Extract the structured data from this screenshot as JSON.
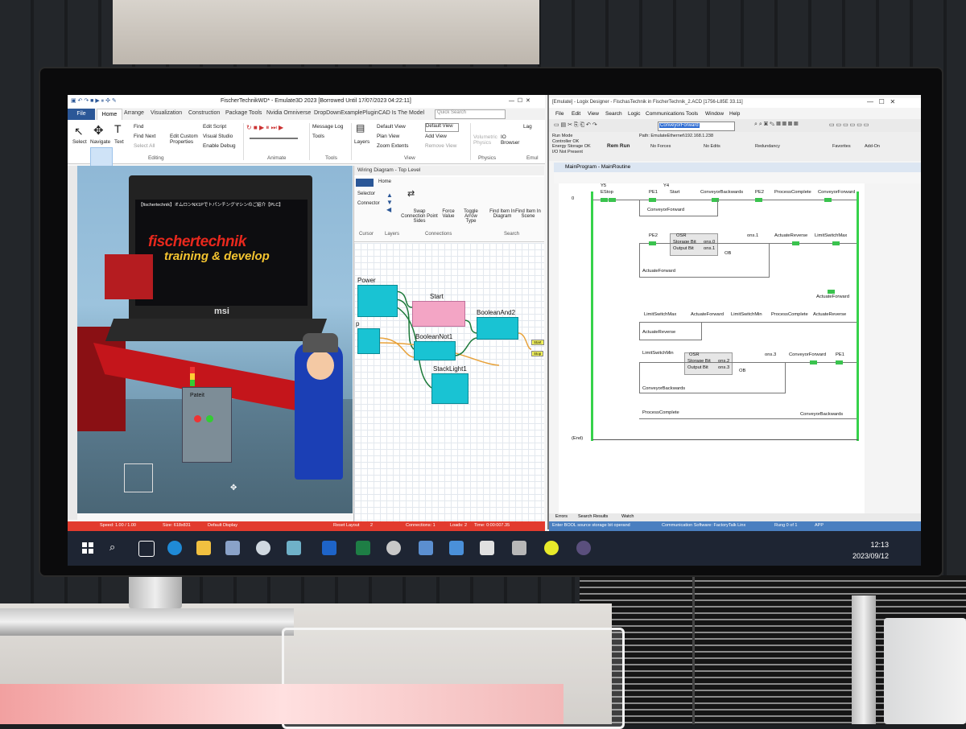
{
  "emulate3d": {
    "title": "FischerTechnikWD* - Emulate3D 2023 [Borrowed Until 17/07/2023 04:22:11]",
    "tabs": [
      "File",
      "Home",
      "Arrange",
      "Visualization",
      "Construction",
      "Package Tools",
      "Nvidia Omniverse",
      "DropDownExamplePlugin",
      "CAD Is The Model"
    ],
    "search_placeholder": "Quick Search",
    "ribbon": {
      "select": "Select",
      "navigate": "Navigate",
      "text": "Text",
      "find": "Find",
      "find_next": "Find Next",
      "select_all": "Select All",
      "edit_custom_properties": "Edit Custom Properties",
      "edit_script": "Edit Script",
      "visual_studio": "Visual Studio",
      "enable_debug": "Enable Debug",
      "message_log": "Message Log",
      "tools": "Tools",
      "layers": "Layers",
      "default_view": "Default View",
      "plan_view": "Plan View",
      "zoom_extents": "Zoom Extents",
      "add_view": "Add View",
      "remove_view": "Remove View",
      "view_select": "Default View",
      "volumetric_physics": "Volumetric Physics",
      "io_browser": "IO Browser",
      "lag": "Lag",
      "groups": {
        "editing": "Editing",
        "animate": "Animate",
        "tools": "Tools",
        "view": "View",
        "physics": "Physics",
        "emul": "Emul"
      }
    },
    "viewport": {
      "video_title": "【fischertechnik】オムロンNX1Pでトパンチングマシンのご紹介【PLC】",
      "brand1": "fischertechnik",
      "brand2": "training & develop",
      "laptop_brand": "msi",
      "panel_label": "Pateit"
    },
    "status": {
      "speed": "Speed: 1.00 / 1.00",
      "size": "Size: 618x831",
      "display": "Default Display",
      "reset_layout": "Reset Layout",
      "count": "2",
      "connections": "Connections: 1",
      "loads": "Loads: 2",
      "time": "Time: 0:00:007.35"
    }
  },
  "wiring": {
    "title": "Wiring Diagram - Top Level",
    "tab_home": "Home",
    "ribbon": {
      "selector": "Selector",
      "connector": "Connector",
      "cursor": "Cursor",
      "layers": "Layers",
      "swap": "Swap Connection Point Sides",
      "force": "Force Value",
      "toggle": "Toggle Arrow Type",
      "connections": "Connections",
      "find_diagram": "Find Item In Diagram",
      "find_scene": "Find Item In Scene",
      "search": "Search"
    },
    "blocks": {
      "power": "Power",
      "start": "Start",
      "boolean_not": "BooleanNot1",
      "boolean_and": "BooleanAnd2",
      "stacklight": "StackLight1",
      "p": "p"
    },
    "tags": {
      "start": "Start",
      "stop": "Stop"
    }
  },
  "logix": {
    "title": "[Emulate] - Logix Designer - FischasTechnik in FischerTechnik_2.ACD [1756-L85E 33.11]",
    "menu": [
      "File",
      "Edit",
      "View",
      "Search",
      "Logic",
      "Communications",
      "Tools",
      "Window",
      "Help"
    ],
    "search_value": "ConveyorForward",
    "run_mode": [
      "Run Mode",
      "Controller OK",
      "Energy Storage OK",
      "I/O Not Present"
    ],
    "rem_run": "Rem Run",
    "path": "Path: EmulateEthernet\\192.168.1.238",
    "no_forces": "No Forces",
    "no_edits": "No Edits",
    "redundancy": "Redundancy",
    "favorites": "Favorites",
    "add_on": "Add-On",
    "routine_tab": "MainProgram - MainRoutine",
    "rung0": {
      "n": "0",
      "y5": "Y5",
      "y4": "Y4",
      "estop": "EStop",
      "pe1": "PE1",
      "start": "Start",
      "conv_back": "ConveyorBackwards",
      "pe2": "PE2",
      "proc_comp": "ProcessComplete",
      "conv_fwd": "ConveyorForward",
      "conv_fwd_branch": "ConveyorForward"
    },
    "rung1": {
      "pe2": "PE2",
      "osr": "OSR",
      "storage": "Storage Bit",
      "output": "Output Bit",
      "ons0": "ons.0",
      "ons1": "ons.1",
      "ons1b": "ons.1",
      "ob": "OB",
      "act_rev": "ActuateReverse",
      "lim_max": "LimitSwitchMax",
      "act_fwd": "ActuateForward",
      "act_fwd_out": "ActuateForward"
    },
    "rung2": {
      "lim_max": "LimitSwitchMax",
      "act_fwd": "ActuateForward",
      "lim_min": "LimitSwitchMin",
      "proc_comp": "ProcessComplete",
      "act_rev": "ActuateReverse",
      "act_rev_branch": "ActuateReverse"
    },
    "rung3": {
      "lim_min": "LimitSwitchMin",
      "osr": "OSR",
      "storage": "Storage Bit",
      "output": "Output Bit",
      "ons2": "ons.2",
      "ons3": "ons.3",
      "ons3b": "ons.3",
      "ob": "OB",
      "conv_fwd": "ConveyorForward",
      "pe1": "PE1",
      "conv_back": "ConveyorBackwards"
    },
    "rung4": {
      "proc_comp": "ProcessComplete",
      "conv_back": "ConveyorBackwards"
    },
    "end": "(End)",
    "bottom_tabs": [
      "Errors",
      "Search Results",
      "Watch"
    ],
    "status_hint": "Enter BOOL source storage bit operand",
    "comm": "Communication Software: FactoryTalk Linx",
    "rung_of": "Rung 0 of 1",
    "app": "APP"
  },
  "taskbar": {
    "time": "12:13",
    "date": "2023/09/12"
  },
  "colors": {
    "rung_green": "#36d24b",
    "block_cyan": "#19c3d3",
    "block_pink": "#f3a5c5",
    "status_red": "#e23b2e",
    "taskbar": "#1e2533"
  }
}
